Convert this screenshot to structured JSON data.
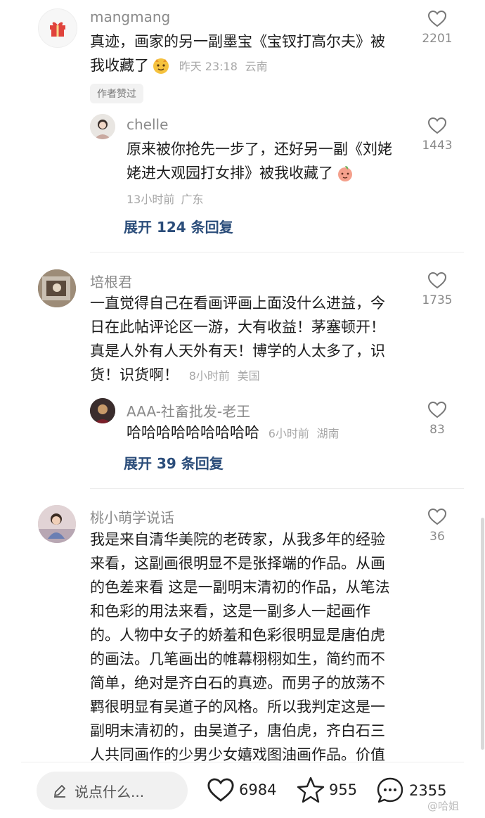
{
  "comments": [
    {
      "username": "mangmang",
      "text_line1": "真迹，画家的另一副墨宝《宝钗打高尔夫》被",
      "text_line2": "我收藏了",
      "time": "昨天 23:18",
      "location": "云南",
      "likes": "2201",
      "badge": "作者赞过",
      "reply": {
        "username": "chelle",
        "text_line1": "原来被你抢先一步了，还好另一副《刘姥",
        "text_line2": "姥进大观园打女排》被我收藏了",
        "time": "13小时前",
        "location": "广东",
        "likes": "1443"
      },
      "expand": "展开 124 条回复"
    },
    {
      "username": "培根君",
      "lines": [
        "一直觉得自己在看画评画上面没什么进益，今",
        "日在此帖评论区一游，大有收益！茅塞顿开！",
        "真是人外有人天外有天！博学的人太多了，识"
      ],
      "last_line": "货！识货啊！",
      "time": "8小时前",
      "location": "美国",
      "likes": "1735",
      "reply": {
        "username": "AAA-社畜批发-老王",
        "text": "哈哈哈哈哈哈哈哈哈",
        "time": "6小时前",
        "location": "湖南",
        "likes": "83"
      },
      "expand": "展开 39 条回复"
    },
    {
      "username": "桃小萌学说话",
      "lines": [
        "我是来自清华美院的老砖家，从我多年的经验",
        "来看，这副画很明显不是张择端的作品。从画",
        "的色差来看 这是一副明末清初的作品，从笔法",
        "和色彩的用法来看，这是一副多人一起画作",
        "的。人物中女子的娇羞和色彩很明显是唐伯虎",
        "的画法。几笔画出的帷幕栩栩如生，简约而不",
        "简单，绝对是齐白石的真迹。而男子的放荡不",
        "羁很明显有吴道子的风格。所以我判定这是一",
        "副明末清初的，由吴道子，唐伯虎，齐白石三",
        "人共同画作的少男少女嬉戏图油画作品。价值"
      ],
      "likes": "36"
    }
  ],
  "bottom_bar": {
    "input_placeholder": "说点什么...",
    "likes": "6984",
    "favorites": "955",
    "comments": "2355",
    "watermark": "@哈姐"
  }
}
